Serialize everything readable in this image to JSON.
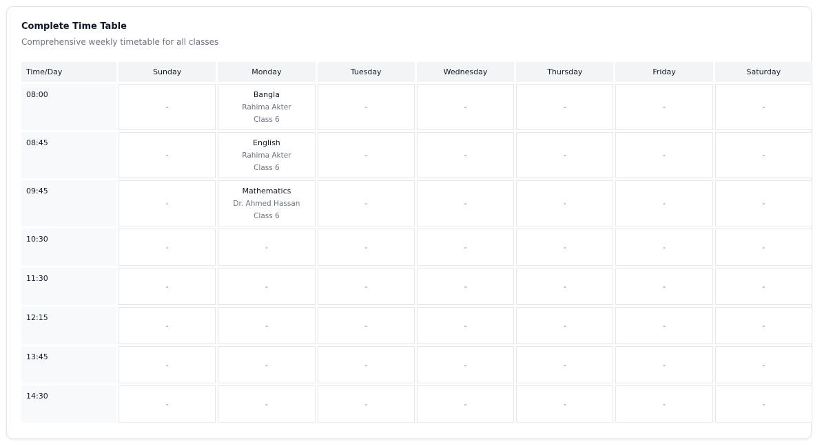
{
  "card": {
    "title": "Complete Time Table",
    "subtitle": "Comprehensive weekly timetable for all classes"
  },
  "table": {
    "corner_label": "Time/Day",
    "days": [
      "Sunday",
      "Monday",
      "Tuesday",
      "Wednesday",
      "Thursday",
      "Friday",
      "Saturday"
    ],
    "empty_marker": "-",
    "rows": [
      {
        "time": "08:00",
        "cells": [
          null,
          {
            "subject": "Bangla",
            "teacher": "Rahima Akter",
            "class": "Class 6"
          },
          null,
          null,
          null,
          null,
          null
        ]
      },
      {
        "time": "08:45",
        "cells": [
          null,
          {
            "subject": "English",
            "teacher": "Rahima Akter",
            "class": "Class 6"
          },
          null,
          null,
          null,
          null,
          null
        ]
      },
      {
        "time": "09:45",
        "cells": [
          null,
          {
            "subject": "Mathematics",
            "teacher": "Dr. Ahmed Hassan",
            "class": "Class 6"
          },
          null,
          null,
          null,
          null,
          null
        ]
      },
      {
        "time": "10:30",
        "cells": [
          null,
          null,
          null,
          null,
          null,
          null,
          null
        ]
      },
      {
        "time": "11:30",
        "cells": [
          null,
          null,
          null,
          null,
          null,
          null,
          null
        ]
      },
      {
        "time": "12:15",
        "cells": [
          null,
          null,
          null,
          null,
          null,
          null,
          null
        ]
      },
      {
        "time": "13:45",
        "cells": [
          null,
          null,
          null,
          null,
          null,
          null,
          null
        ]
      },
      {
        "time": "14:30",
        "cells": [
          null,
          null,
          null,
          null,
          null,
          null,
          null
        ]
      }
    ]
  }
}
